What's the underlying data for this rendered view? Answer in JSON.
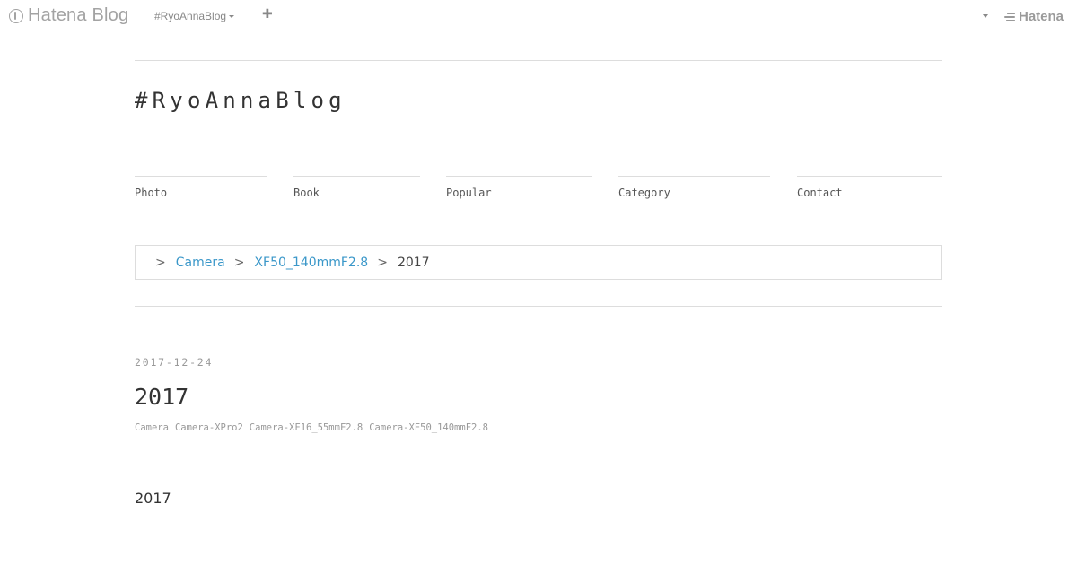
{
  "global_header": {
    "logo_text": "Hatena Blog",
    "blog_switcher_label": "#RyoAnnaBlog",
    "add_label": "✚",
    "hatena_logo_text": "Hatena"
  },
  "blog": {
    "title": "#RyoAnnaBlog"
  },
  "nav": {
    "items": [
      {
        "label": "Photo"
      },
      {
        "label": "Book"
      },
      {
        "label": "Popular"
      },
      {
        "label": "Category"
      },
      {
        "label": "Contact"
      }
    ]
  },
  "breadcrumb": {
    "separator": ">",
    "items": [
      {
        "label": "Camera",
        "link": true
      },
      {
        "label": "XF50_140mmF2.8",
        "link": true
      },
      {
        "label": "2017",
        "link": false
      }
    ]
  },
  "entry": {
    "date": "2017-12-24",
    "title": "2017",
    "categories": [
      "Camera",
      "Camera-XPro2",
      "Camera-XF16_55mmF2.8",
      "Camera-XF50_140mmF2.8"
    ],
    "body_text": "2017"
  },
  "colors": {
    "link": "#3a97c9",
    "muted": "#999999",
    "divider": "#dddddd",
    "text": "#333333"
  }
}
